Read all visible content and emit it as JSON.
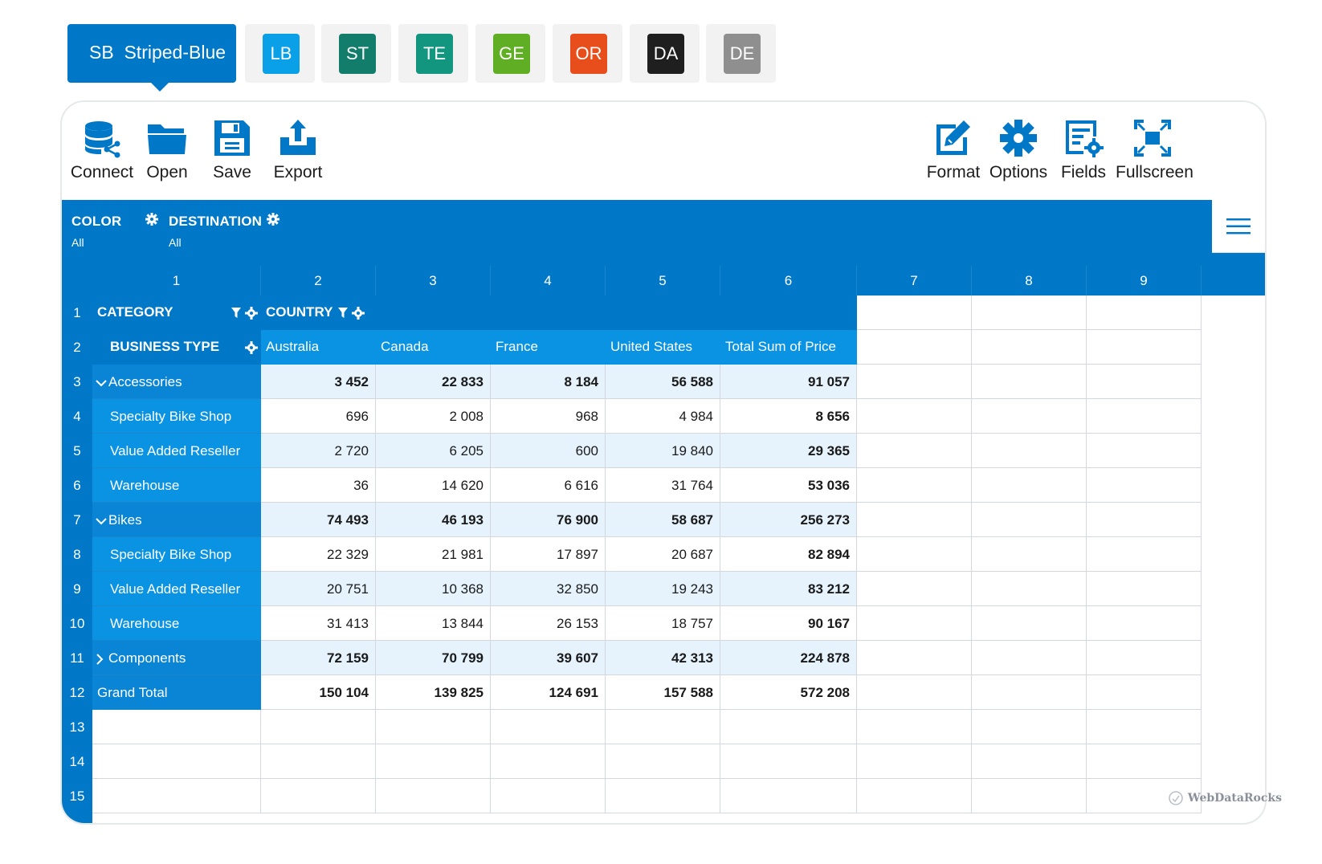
{
  "themes": [
    {
      "code": "SB",
      "name": "Striped-Blue",
      "active": true,
      "color": "#0078c8"
    },
    {
      "code": "LB",
      "color": "#0aa0e8"
    },
    {
      "code": "ST",
      "color": "#127d6a"
    },
    {
      "code": "TE",
      "color": "#13967f"
    },
    {
      "code": "GE",
      "color": "#5fae24"
    },
    {
      "code": "OR",
      "color": "#e84e1c"
    },
    {
      "code": "DA",
      "color": "#1f1f1f"
    },
    {
      "code": "DE",
      "color": "#8f8f8f"
    }
  ],
  "toolbar": {
    "connect": "Connect",
    "open": "Open",
    "save": "Save",
    "export": "Export",
    "format": "Format",
    "options": "Options",
    "fields": "Fields",
    "fullscreen": "Fullscreen"
  },
  "filters": [
    {
      "name": "COLOR",
      "value": "All"
    },
    {
      "name": "DESTINATION",
      "value": "All"
    }
  ],
  "grid": {
    "column_numbers": [
      "1",
      "2",
      "3",
      "4",
      "5",
      "6",
      "7",
      "8",
      "9"
    ],
    "row_numbers": [
      "1",
      "2",
      "3",
      "4",
      "5",
      "6",
      "7",
      "8",
      "9",
      "10",
      "11",
      "12",
      "13",
      "14",
      "15"
    ],
    "category_header": "CATEGORY",
    "country_header": "COUNTRY",
    "business_type_header": "BUSINESS TYPE",
    "countries": [
      "Australia",
      "Canada",
      "France",
      "United States",
      "Total Sum of Price"
    ],
    "rows": [
      {
        "label": "Accessories",
        "level": 0,
        "expander": "down",
        "values": [
          "3 452",
          "22 833",
          "8 184",
          "56 588",
          "91 057"
        ],
        "bold": true,
        "striped": true
      },
      {
        "label": "Specialty Bike Shop",
        "level": 1,
        "values": [
          "696",
          "2 008",
          "968",
          "4 984",
          "8 656"
        ],
        "bold": false,
        "striped": false
      },
      {
        "label": "Value Added Reseller",
        "level": 1,
        "values": [
          "2 720",
          "6 205",
          "600",
          "19 840",
          "29 365"
        ],
        "bold": false,
        "striped": true
      },
      {
        "label": "Warehouse",
        "level": 1,
        "values": [
          "36",
          "14 620",
          "6 616",
          "31 764",
          "53 036"
        ],
        "bold": false,
        "striped": false
      },
      {
        "label": "Bikes",
        "level": 0,
        "expander": "down",
        "values": [
          "74 493",
          "46 193",
          "76 900",
          "58 687",
          "256 273"
        ],
        "bold": true,
        "striped": true
      },
      {
        "label": "Specialty Bike Shop",
        "level": 1,
        "values": [
          "22 329",
          "21 981",
          "17 897",
          "20 687",
          "82 894"
        ],
        "bold": false,
        "striped": false
      },
      {
        "label": "Value Added Reseller",
        "level": 1,
        "values": [
          "20 751",
          "10 368",
          "32 850",
          "19 243",
          "83 212"
        ],
        "bold": false,
        "striped": true
      },
      {
        "label": "Warehouse",
        "level": 1,
        "values": [
          "31 413",
          "13 844",
          "26 153",
          "18 757",
          "90 167"
        ],
        "bold": false,
        "striped": false
      },
      {
        "label": "Components",
        "level": 0,
        "expander": "right",
        "values": [
          "72 159",
          "70 799",
          "39 607",
          "42 313",
          "224 878"
        ],
        "bold": true,
        "striped": true
      },
      {
        "label": "Grand Total",
        "level": -1,
        "values": [
          "150 104",
          "139 825",
          "124 691",
          "157 588",
          "572 208"
        ],
        "bold": true,
        "striped": false
      }
    ]
  },
  "brand": "WebDataRocks"
}
